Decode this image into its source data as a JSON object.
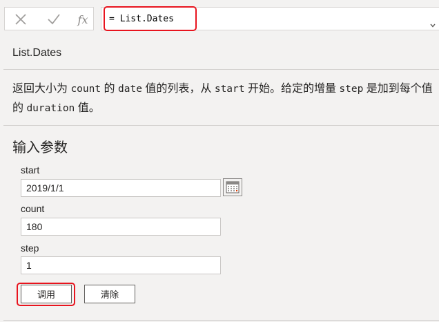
{
  "formula_bar": {
    "cancel_icon": "close-icon",
    "commit_icon": "check-icon",
    "fx_label": "fx",
    "formula": "= List.Dates",
    "expand_icon": "chevron-down-icon"
  },
  "function": {
    "name": "List.Dates",
    "description": {
      "p1": "返回大小为 ",
      "code1": "count",
      "p2": " 的 ",
      "code2": "date",
      "p3": " 值的列表，从 ",
      "code3": "start",
      "p4": " 开始。给定的增量 ",
      "code4": "step",
      "p5": " 是加到每个值的 ",
      "code5": "duration",
      "p6": " 值。"
    }
  },
  "parameters": {
    "heading": "输入参数",
    "start": {
      "label": "start",
      "value": "2019/1/1"
    },
    "count": {
      "label": "count",
      "value": "180"
    },
    "step": {
      "label": "step",
      "value": "1"
    },
    "calendar_icon": "calendar-icon"
  },
  "actions": {
    "invoke_label": "调用",
    "clear_label": "清除"
  },
  "colors": {
    "highlight": "#e8141e",
    "background": "#f3f2f1"
  }
}
